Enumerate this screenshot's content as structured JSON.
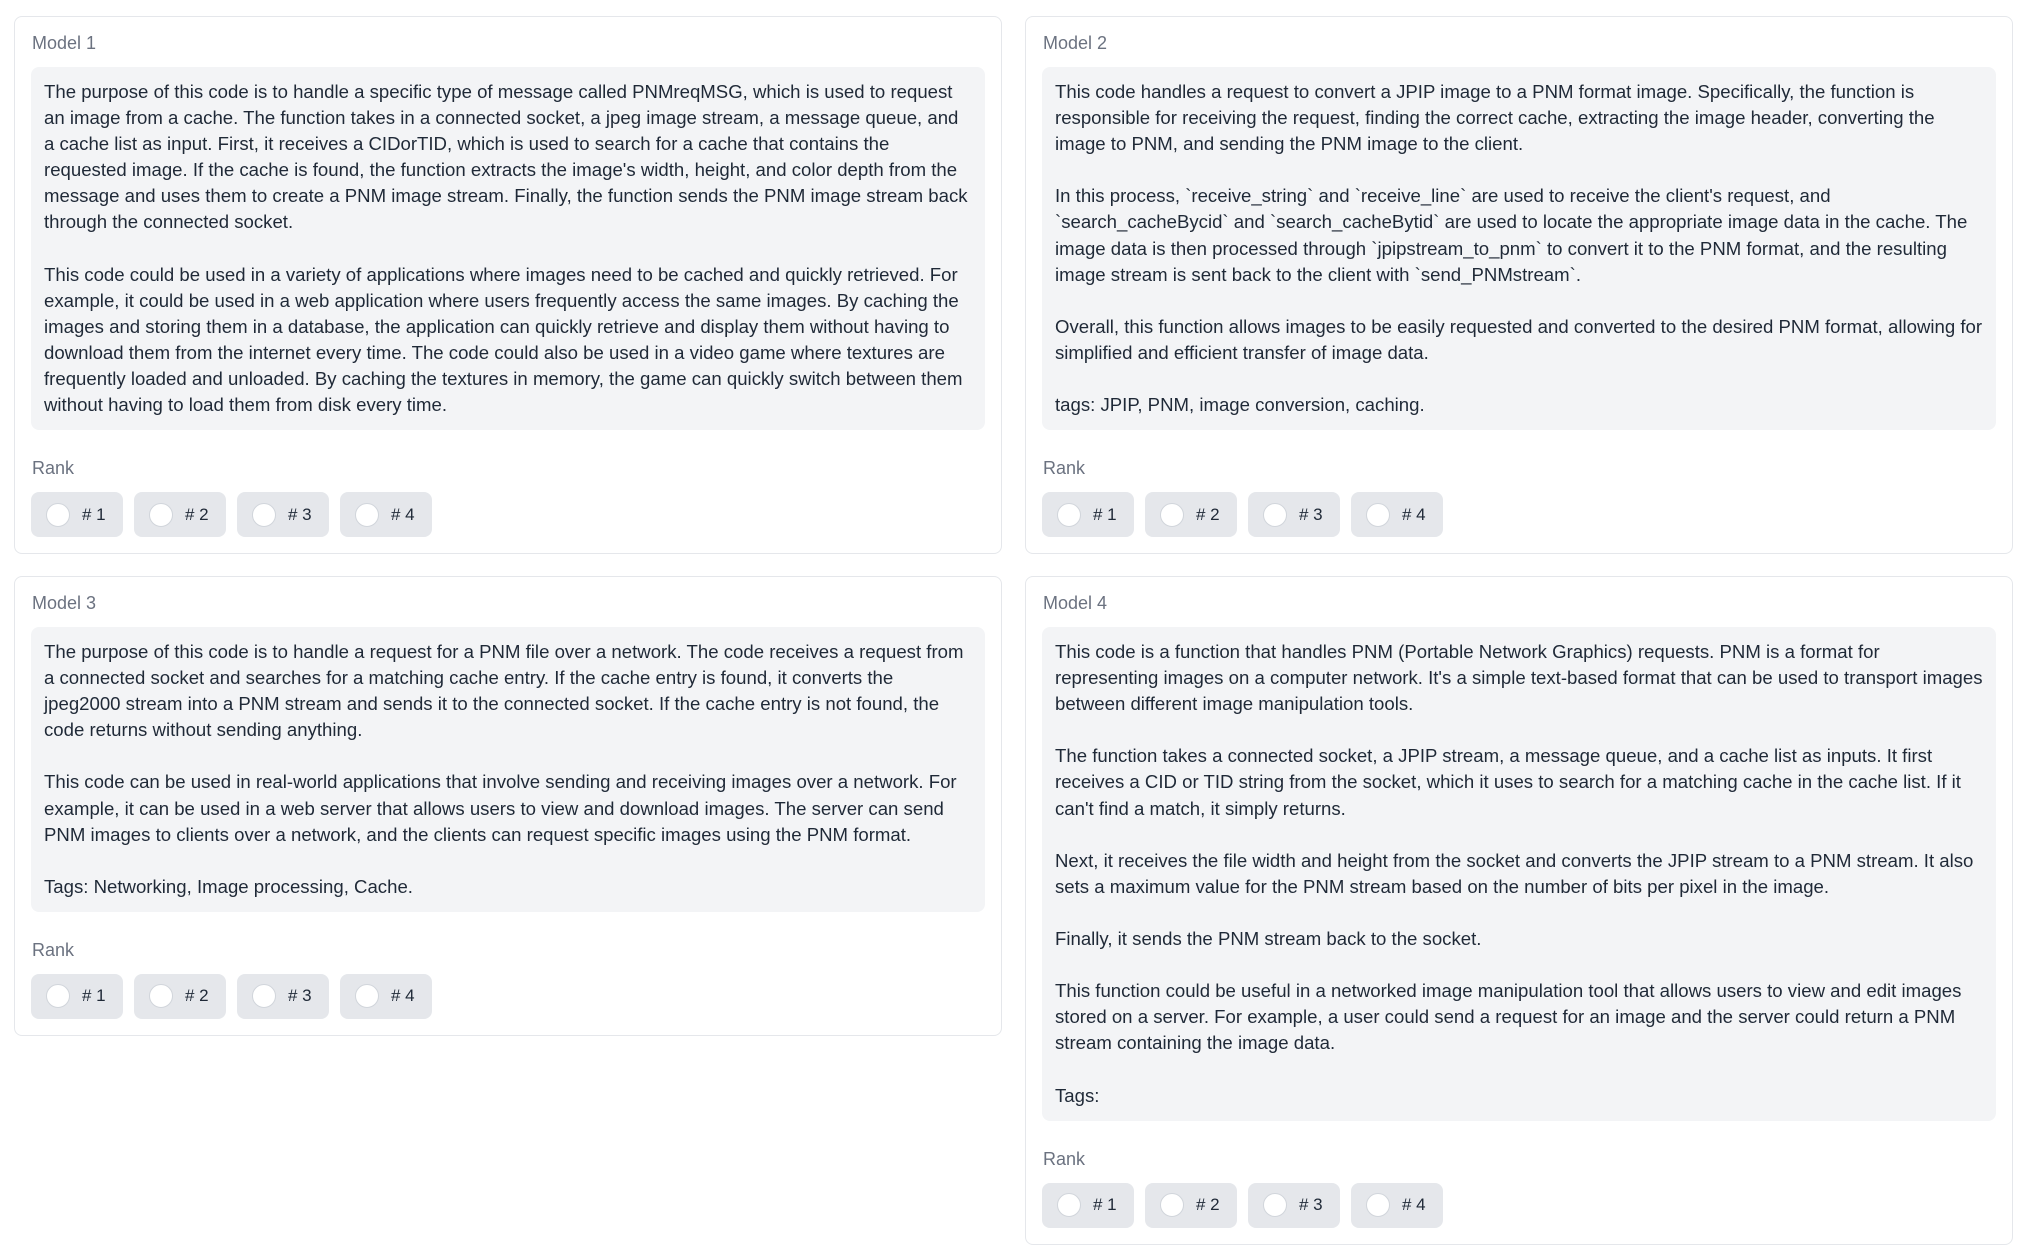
{
  "rank_label": "Rank",
  "rank_options": [
    "# 1",
    "# 2",
    "# 3",
    "# 4"
  ],
  "models": [
    {
      "label": "Model 1",
      "paragraphs": [
        "The purpose of this code is to handle a specific type of message called PNMreqMSG, which is used to request an image from a cache. The function takes in a connected socket, a jpeg image stream, a message queue, and a cache list as input. First, it receives a CIDorTID, which is used to search for a cache that contains the requested image. If the cache is found, the function extracts the image's width, height, and color depth from the message and uses them to create a PNM image stream. Finally, the function sends the PNM image stream back through the connected socket.",
        "This code could be used in a variety of applications where images need to be cached and quickly retrieved. For example, it could be used in a web application where users frequently access the same images. By caching the images and storing them in a database, the application can quickly retrieve and display them without having to download them from the internet every time. The code could also be used in a video game where textures are frequently loaded and unloaded. By caching the textures in memory, the game can quickly switch between them without having to load them from disk every time."
      ]
    },
    {
      "label": "Model 2",
      "paragraphs": [
        "This code handles a request to convert a JPIP image to a PNM format image. Specifically, the function is responsible for receiving the request, finding the correct cache, extracting the image header, converting the image to PNM, and sending the PNM image to the client.",
        "In this process, `receive_string` and `receive_line` are used to receive the client's request, and `search_cacheBycid` and `search_cacheBytid` are used to locate the appropriate image data in the cache. The image data is then processed through `jpipstream_to_pnm` to convert it to the PNM format, and the resulting image stream is sent back to the client with `send_PNMstream`.",
        "Overall, this function allows images to be easily requested and converted to the desired PNM format, allowing for simplified and efficient transfer of image data.",
        "tags: JPIP, PNM, image conversion, caching."
      ]
    },
    {
      "label": "Model 3",
      "paragraphs": [
        "The purpose of this code is to handle a request for a PNM file over a network. The code receives a request from a connected socket and searches for a matching cache entry. If the cache entry is found, it converts the jpeg2000 stream into a PNM stream and sends it to the connected socket. If the cache entry is not found, the code returns without sending anything.",
        "This code can be used in real-world applications that involve sending and receiving images over a network. For example, it can be used in a web server that allows users to view and download images. The server can send PNM images to clients over a network, and the clients can request specific images using the PNM format.",
        "Tags: Networking, Image processing, Cache."
      ]
    },
    {
      "label": "Model 4",
      "paragraphs": [
        "This code is a function that handles PNM (Portable Network Graphics) requests. PNM is a format for representing images on a computer network. It's a simple text-based format that can be used to transport images between different image manipulation tools.",
        "The function takes a connected socket, a JPIP stream, a message queue, and a cache list as inputs. It first receives a CID or TID string from the socket, which it uses to search for a matching cache in the cache list. If it can't find a match, it simply returns.",
        "Next, it receives the file width and height from the socket and converts the JPIP stream to a PNM stream. It also sets a maximum value for the PNM stream based on the number of bits per pixel in the image.",
        "Finally, it sends the PNM stream back to the socket.",
        "This function could be useful in a networked image manipulation tool that allows users to view and edit images stored on a server. For example, a user could send a request for an image and the server could return a PNM stream containing the image data.",
        "Tags:"
      ]
    }
  ]
}
